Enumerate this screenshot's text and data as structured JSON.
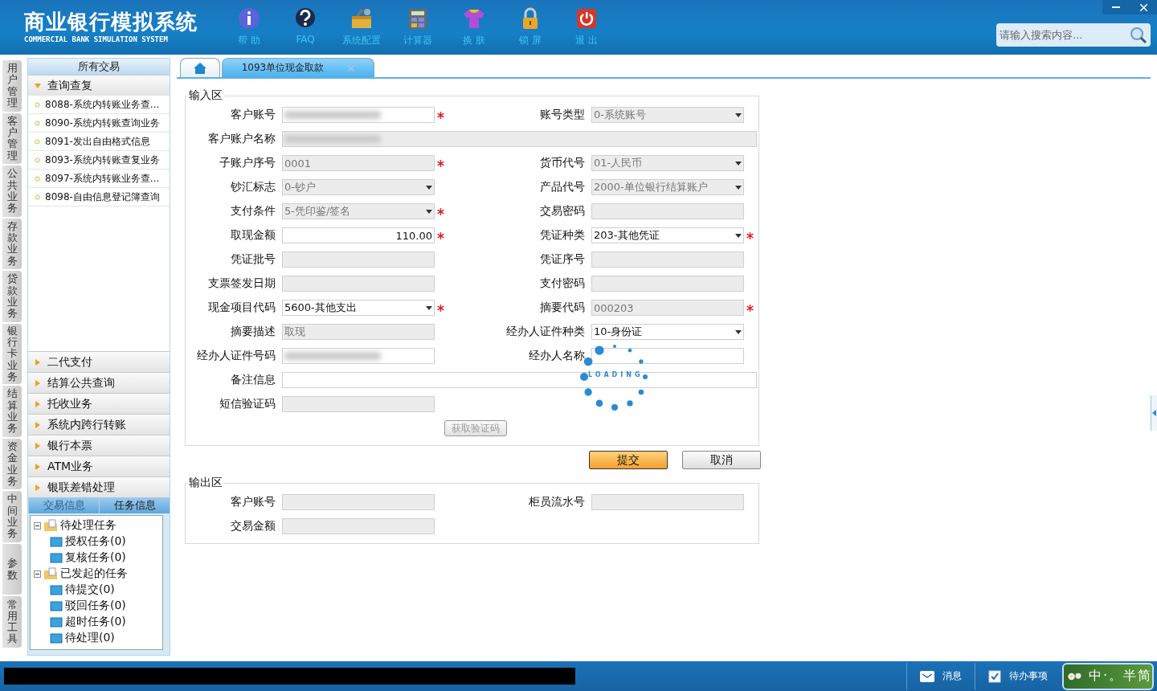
{
  "header": {
    "title": "商业银行模拟系统",
    "subtitle": "COMMERCIAL BANK SIMULATION SYSTEM",
    "toolbar": [
      {
        "kind": "info",
        "label": "帮 助"
      },
      {
        "kind": "faq",
        "label": "FAQ"
      },
      {
        "kind": "config",
        "label": "系统配置"
      },
      {
        "kind": "calc",
        "label": "计算器"
      },
      {
        "kind": "skin",
        "label": "换 肤"
      },
      {
        "kind": "lock",
        "label": "锁 屏"
      },
      {
        "kind": "exit",
        "label": "退 出"
      }
    ],
    "search": {
      "placeholder": "请输入搜索内容..."
    }
  },
  "side_tabs": [
    {
      "label": "用户管理"
    },
    {
      "label": "客户管理"
    },
    {
      "label": "公共业务"
    },
    {
      "label": "存款业务"
    },
    {
      "label": "贷款业务"
    },
    {
      "label": "银行卡业务"
    },
    {
      "label": "结算业务"
    },
    {
      "label": "资金业务"
    },
    {
      "label": "中间业务"
    },
    {
      "label": "参数"
    },
    {
      "label": "常用工具"
    }
  ],
  "sidebar": {
    "title": "所有交易",
    "groups": [
      {
        "label": "查询查复",
        "expanded": true,
        "items": [
          "8088-系统内转账业务查...",
          "8090-系统内转账查询业务",
          "8091-发出自由格式信息",
          "8093-系统内转账查复业务",
          "8097-系统内转账业务查...",
          "8098-自由信息登记簿查询"
        ]
      },
      {
        "label": "二代支付",
        "expanded": false
      },
      {
        "label": "结算公共查询",
        "expanded": false
      },
      {
        "label": "托收业务",
        "expanded": false
      },
      {
        "label": "系统内跨行转账",
        "expanded": false
      },
      {
        "label": "银行本票",
        "expanded": false
      },
      {
        "label": "ATM业务",
        "expanded": false
      },
      {
        "label": "银联差错处理",
        "expanded": false
      }
    ],
    "info_tabs": [
      {
        "label": "交易信息",
        "selected": false
      },
      {
        "label": "任务信息",
        "selected": true
      }
    ],
    "tree": [
      {
        "label": "待处理任务",
        "expanded": true,
        "children": [
          {
            "label": "授权任务(0)"
          },
          {
            "label": "复核任务(0)"
          }
        ]
      },
      {
        "label": "已发起的任务",
        "expanded": true,
        "children": [
          {
            "label": "待提交(0)"
          },
          {
            "label": "驳回任务(0)"
          },
          {
            "label": "超时任务(0)"
          },
          {
            "label": "待处理(0)"
          }
        ]
      }
    ]
  },
  "tabs": [
    {
      "kind": "home",
      "selected": false
    },
    {
      "kind": "page",
      "label": "1093单位现金取款",
      "selected": true
    }
  ],
  "input_area": {
    "title": "输入区",
    "rows": [
      [
        {
          "label": "客户账号",
          "kind": "text",
          "redacted": true,
          "disabled": false,
          "required": true
        },
        {
          "label": "账号类型",
          "kind": "select",
          "value": "0-系统账号",
          "disabled": true,
          "required": false
        }
      ],
      [
        {
          "label": "客户账户名称",
          "kind": "text",
          "redacted": true,
          "disabled": true,
          "required": false,
          "wide": true
        }
      ],
      [
        {
          "label": "子账户序号",
          "kind": "text",
          "value": "0001",
          "disabled": true,
          "required": true
        },
        {
          "label": "货币代号",
          "kind": "select",
          "value": "01-人民币",
          "disabled": true,
          "required": false
        }
      ],
      [
        {
          "label": "钞汇标志",
          "kind": "select",
          "value": "0-钞户",
          "disabled": true,
          "required": false
        },
        {
          "label": "产品代号",
          "kind": "select",
          "value": "2000-单位银行结算账户",
          "disabled": true,
          "required": false
        }
      ],
      [
        {
          "label": "支付条件",
          "kind": "select",
          "value": "5-凭印鉴/签名",
          "disabled": true,
          "required": true
        },
        {
          "label": "交易密码",
          "kind": "text",
          "disabled": true,
          "required": false
        }
      ],
      [
        {
          "label": "取现金额",
          "kind": "amount",
          "value": "110.00",
          "disabled": false,
          "required": true
        },
        {
          "label": "凭证种类",
          "kind": "select",
          "value": "203-其他凭证",
          "disabled": false,
          "required": true
        }
      ],
      [
        {
          "label": "凭证批号",
          "kind": "text",
          "disabled": true,
          "required": false
        },
        {
          "label": "凭证序号",
          "kind": "text",
          "disabled": true,
          "required": false
        }
      ],
      [
        {
          "label": "支票签发日期",
          "kind": "text",
          "disabled": true,
          "required": false
        },
        {
          "label": "支付密码",
          "kind": "text",
          "disabled": true,
          "required": false
        }
      ],
      [
        {
          "label": "现金项目代码",
          "kind": "select",
          "value": "5600-其他支出",
          "disabled": false,
          "required": true
        },
        {
          "label": "摘要代码",
          "kind": "text",
          "value": "000203",
          "disabled": true,
          "required": true
        }
      ],
      [
        {
          "label": "摘要描述",
          "kind": "text",
          "value": "取现",
          "disabled": true,
          "required": false
        },
        {
          "label": "经办人证件种类",
          "kind": "select",
          "value": "10-身份证",
          "disabled": false,
          "required": false
        }
      ],
      [
        {
          "label": "经办人证件号码",
          "kind": "text",
          "redacted": true,
          "disabled": false,
          "required": false
        },
        {
          "label": "经办人名称",
          "kind": "text",
          "disabled": false,
          "required": false
        }
      ],
      [
        {
          "label": "备注信息",
          "kind": "text",
          "disabled": false,
          "required": false,
          "wide": true
        }
      ],
      [
        {
          "label": "短信验证码",
          "kind": "text",
          "disabled": true,
          "required": false
        },
        {
          "kind": "button",
          "label": "获取验证码",
          "disabled": true
        }
      ]
    ]
  },
  "actions": [
    {
      "label": "提交",
      "primary": true
    },
    {
      "label": "取消",
      "primary": false
    }
  ],
  "output_area": {
    "title": "输出区",
    "rows": [
      [
        {
          "label": "客户账号",
          "kind": "text",
          "disabled": true,
          "required": false
        },
        {
          "label": "柜员流水号",
          "kind": "text",
          "disabled": true,
          "required": false
        }
      ],
      [
        {
          "label": "交易金额",
          "kind": "text",
          "disabled": true,
          "required": false
        }
      ]
    ]
  },
  "loading": {
    "text": "LOADING"
  },
  "status_bar": {
    "items": [
      {
        "kind": "mail",
        "label": "消息"
      },
      {
        "kind": "todo",
        "label": "待办事项"
      }
    ],
    "ime": "中·。半简"
  }
}
